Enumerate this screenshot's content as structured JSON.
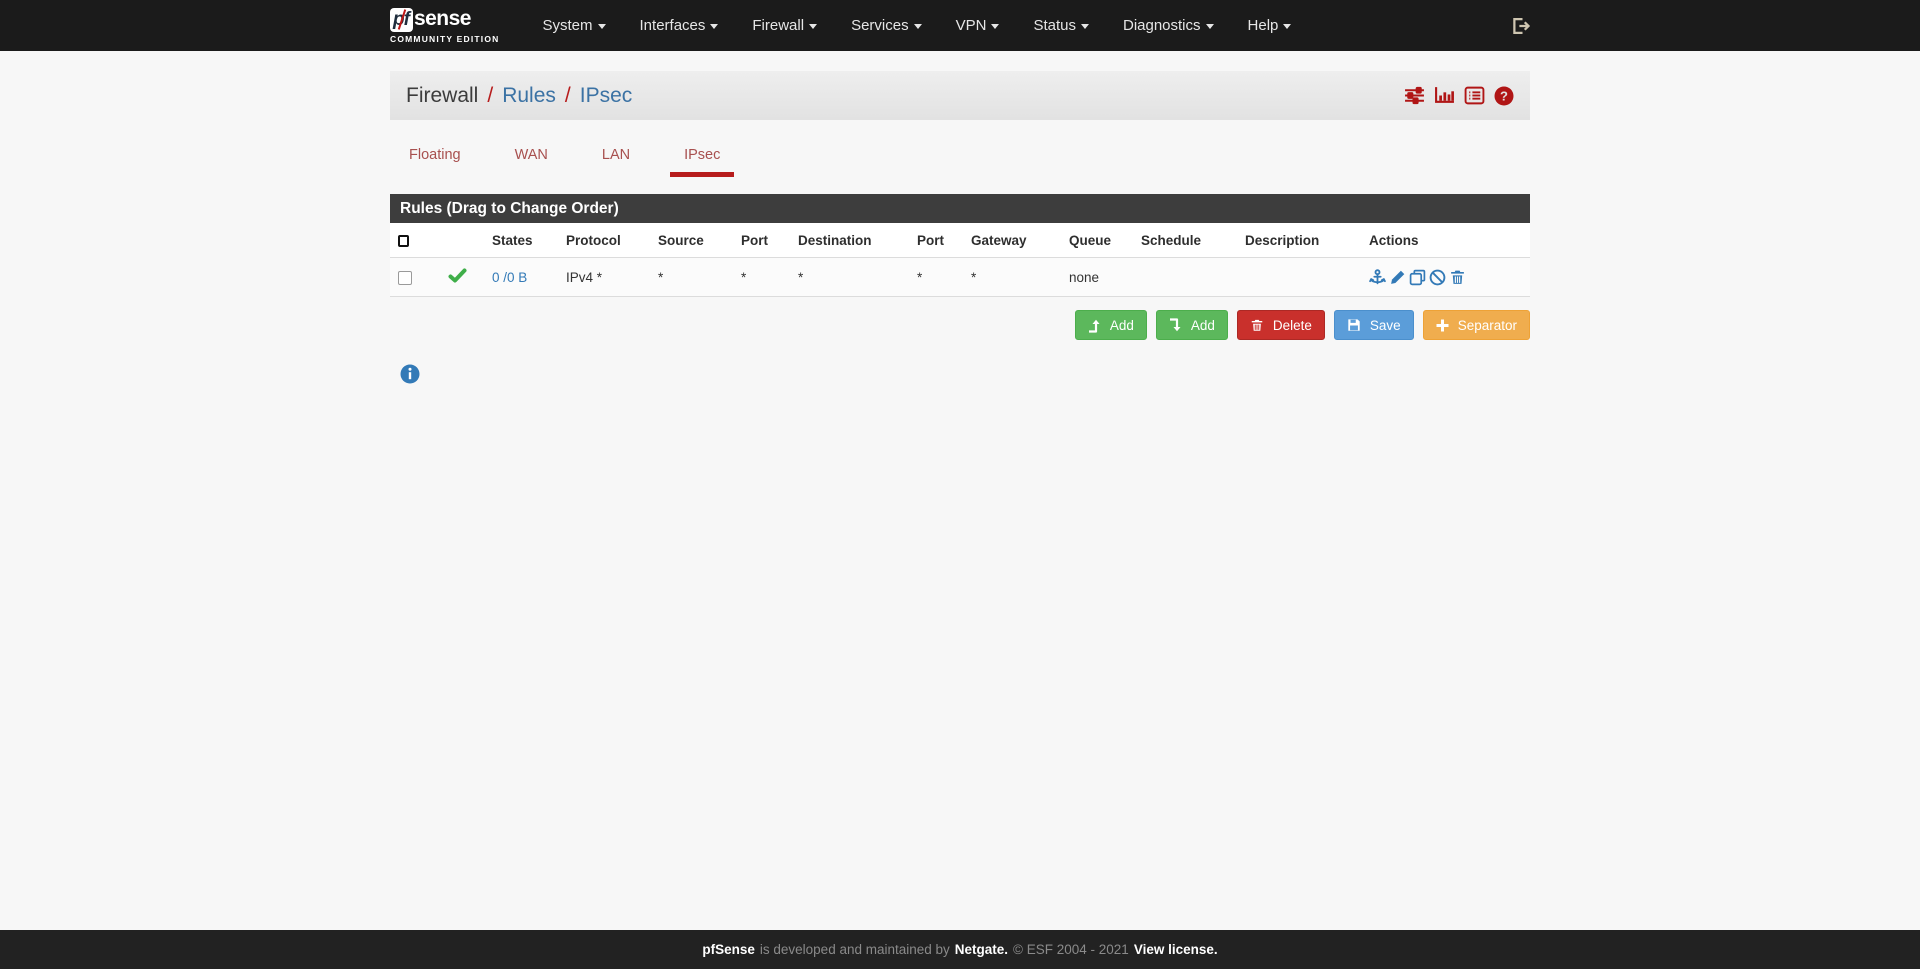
{
  "navbar": {
    "brand_pf": "pf",
    "brand_sense": "sense",
    "brand_edition": "COMMUNITY EDITION",
    "menu": [
      {
        "label": "System"
      },
      {
        "label": "Interfaces"
      },
      {
        "label": "Firewall"
      },
      {
        "label": "Services"
      },
      {
        "label": "VPN"
      },
      {
        "label": "Status"
      },
      {
        "label": "Diagnostics"
      },
      {
        "label": "Help"
      }
    ]
  },
  "breadcrumb": {
    "root": "Firewall",
    "sep1": "/",
    "level1": "Rules",
    "sep2": "/",
    "level2": "IPsec"
  },
  "tabs": {
    "floating": "Floating",
    "wan": "WAN",
    "lan": "LAN",
    "ipsec": "IPsec"
  },
  "rules": {
    "panel_title": "Rules (Drag to Change Order)",
    "columns": {
      "states": "States",
      "protocol": "Protocol",
      "source": "Source",
      "source_port": "Port",
      "destination": "Destination",
      "destination_port": "Port",
      "gateway": "Gateway",
      "queue": "Queue",
      "schedule": "Schedule",
      "description": "Description",
      "actions": "Actions"
    },
    "row": {
      "states": "0 /0 B",
      "protocol": "IPv4 *",
      "source": "*",
      "source_port": "*",
      "destination": "*",
      "destination_port": "*",
      "gateway": "*",
      "queue": "none",
      "schedule": "",
      "description": ""
    }
  },
  "actions_bar": {
    "add_up": "Add",
    "add_down": "Add",
    "delete": "Delete",
    "save": "Save",
    "separator": "Separator"
  },
  "footer": {
    "brand": "pfSense",
    "text": "is developed and maintained by",
    "netgate": "Netgate.",
    "copyright": "© ESF 2004 - 2021",
    "license": "View license."
  },
  "colors": {
    "brand_red": "#b71c1c",
    "link_blue": "#337ab7",
    "success_green": "#5cb85c",
    "danger_red": "#c9302c",
    "save_blue": "#5b9dd9",
    "warning_orange": "#f0ad4e",
    "check_green": "#3fae49",
    "navbar_bg": "#1b1b1b",
    "footer_bg": "#222222",
    "panel_header_bg": "#3d3d3d"
  }
}
